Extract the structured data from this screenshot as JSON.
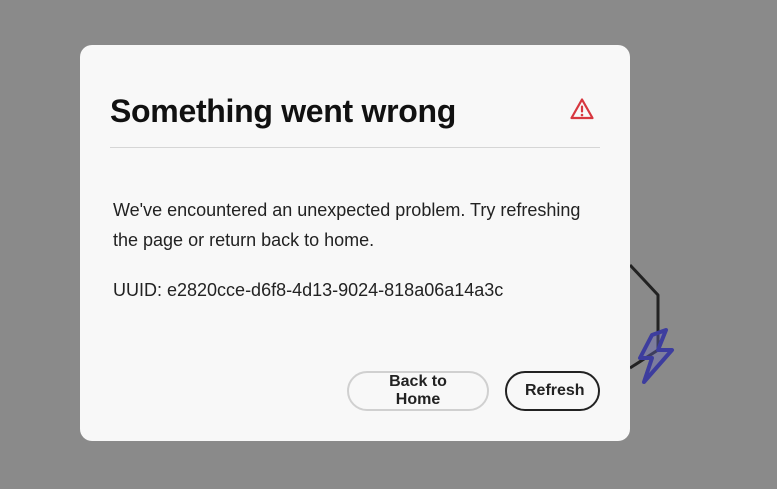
{
  "dialog": {
    "title": "Something went wrong",
    "icon": "alert-triangle-icon",
    "icon_color": "#d7373f",
    "message": "We've encountered an unexpected problem. Try refreshing the page or return back to home.",
    "uuid_text": "UUID: e2820cce-d6f8-4d13-9024-818a06a14a3c",
    "back_home_label": "Back to Home",
    "refresh_label": "Refresh"
  },
  "colors": {
    "backdrop": "#8a8a8a",
    "dialog_bg": "#f8f8f8",
    "illustration_accent": "#3d3d9e"
  }
}
